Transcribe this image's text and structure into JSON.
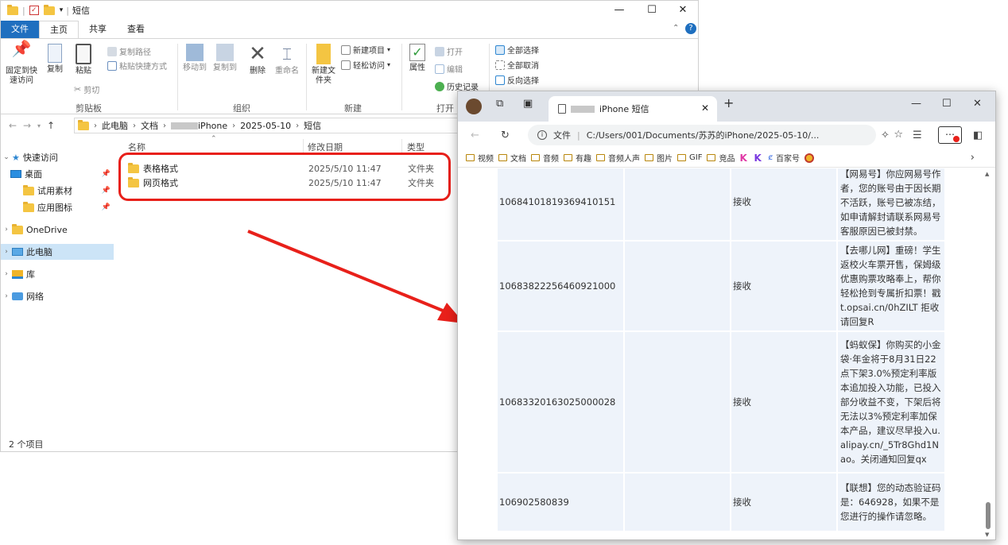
{
  "explorer": {
    "window_title": "短信",
    "ribbon_tabs": [
      "文件",
      "主页",
      "共享",
      "查看"
    ],
    "ribbon": {
      "pin_label": "固定到快速访问",
      "copy_label": "复制",
      "paste_label": "粘贴",
      "copy_path_label": "复制路径",
      "paste_shortcut_label": "粘贴快捷方式",
      "cut_label": "剪切",
      "clipboard_group": "剪贴板",
      "move_to_label": "移动到",
      "copy_to_label": "复制到",
      "delete_label": "删除",
      "rename_label": "重命名",
      "organize_group": "组织",
      "new_item_label": "新建项目",
      "easy_access_label": "轻松访问",
      "new_folder_label": "新建文件夹",
      "new_group": "新建",
      "properties_label": "属性",
      "open_label": "打开",
      "edit_label": "编辑",
      "history_label": "历史记录",
      "open_group": "打开",
      "select_all_label": "全部选择",
      "select_none_label": "全部取消",
      "invert_label": "反向选择"
    },
    "breadcrumb": [
      "此电脑",
      "文档",
      "iPhone",
      "2025-05-10",
      "短信"
    ],
    "nav": {
      "quick_access": "快速访问",
      "desktop": "桌面",
      "trial_material": "试用素材",
      "app_icons": "应用图标",
      "onedrive": "OneDrive",
      "this_pc": "此电脑",
      "library": "库",
      "network": "网络"
    },
    "columns": {
      "name": "名称",
      "date": "修改日期",
      "type": "类型"
    },
    "files": [
      {
        "name": "表格格式",
        "date": "2025/5/10 11:47",
        "type": "文件夹"
      },
      {
        "name": "网页格式",
        "date": "2025/5/10 11:47",
        "type": "文件夹"
      }
    ],
    "status": "2 个项目"
  },
  "browser": {
    "tab_title": "iPhone 短信",
    "url_prefix": "文件",
    "url": "C:/Users/001/Documents/苏苏的iPhone/2025-05-10/...",
    "bookmarks": [
      "视频",
      "文档",
      "音频",
      "有趣",
      "音频人声",
      "图片",
      "GIF",
      "竞品",
      "百家号"
    ],
    "sms_rows": [
      {
        "number": "10684101819369410151",
        "direction": "接收",
        "message": "【网易号】你应网易号作者，您的账号由于因长期不活跃，账号已被冻结，如申请解封请联系网易号客服原因已被封禁。"
      },
      {
        "number": "10683822256460921000",
        "direction": "接收",
        "message": "【去哪儿网】重磅！学生返校火车票开售，保姆级优惠购票攻略奉上，帮你轻松抢到专属折扣票！戳 t.opsai.cn/0hZILT 拒收请回复R"
      },
      {
        "number": "10683320163025000028",
        "direction": "接收",
        "message": "【蚂蚁保】你购买的小金袋·年金将于8月31日22点下架3.0%预定利率版本追加投入功能，已投入部分收益不变，下架后将无法以3%预定利率加保本产品，建议尽早投入u.alipay.cn/_5Tr8Ghd1Nao。关闭通知回复qx"
      },
      {
        "number": "106902580839",
        "direction": "接收",
        "message": "【联想】您的动态验证码是：646928，如果不是您进行的操作请忽略。"
      }
    ]
  },
  "colors": {
    "highlight": "#e8201a",
    "file_tab": "#1f6fbf",
    "table_cell": "#eef3fa"
  }
}
